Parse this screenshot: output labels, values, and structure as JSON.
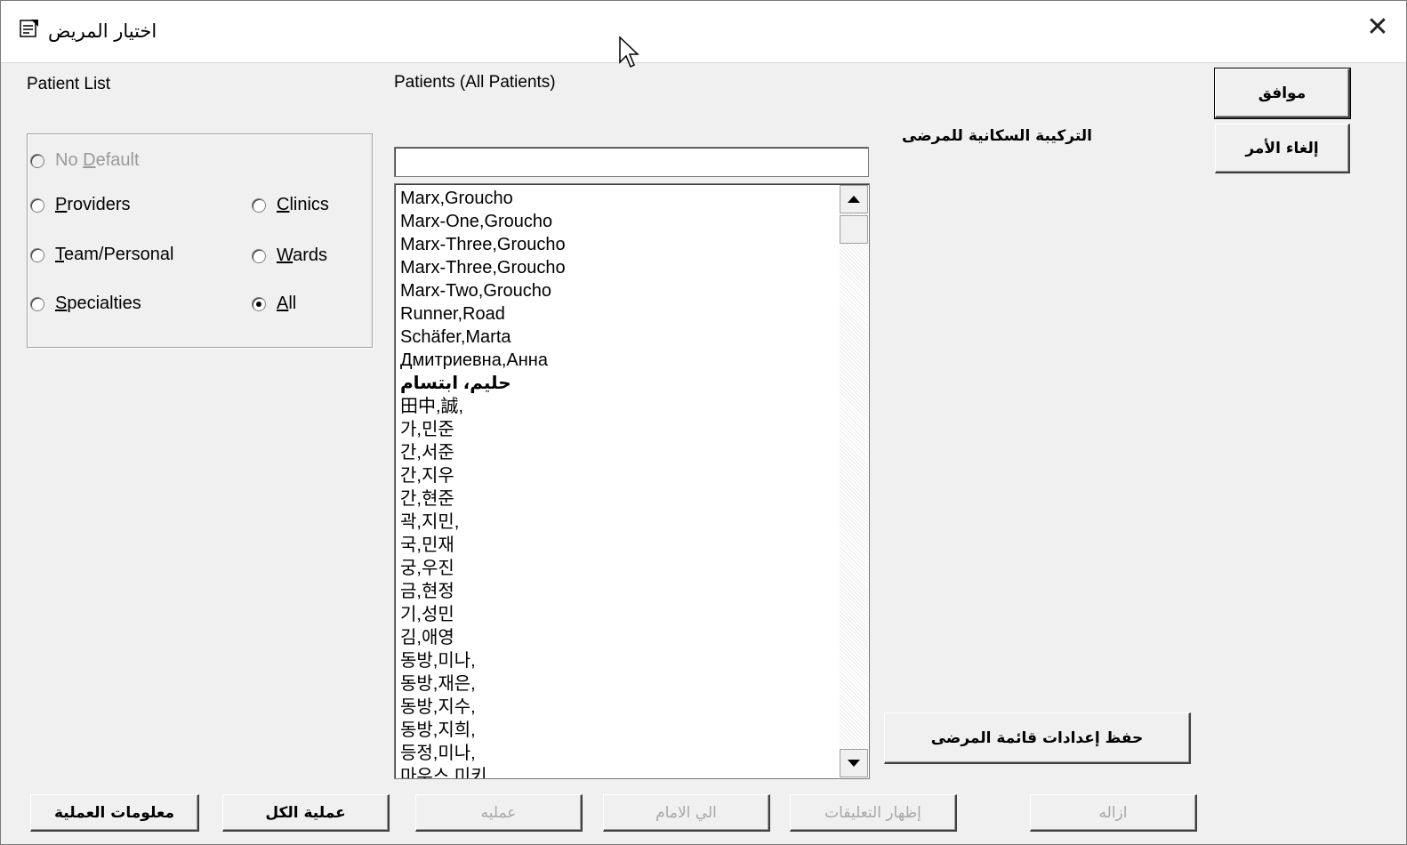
{
  "window": {
    "title": "اختيار المريض",
    "close_symbol": "✕"
  },
  "patient_list_panel": {
    "heading": "Patient List",
    "options": [
      {
        "key": "no_default",
        "label_prefix": "No ",
        "label_underlined": "D",
        "label_suffix": "efault",
        "checked": false,
        "disabled": true
      },
      {
        "key": "providers",
        "label_prefix": "",
        "label_underlined": "P",
        "label_suffix": "roviders",
        "checked": false,
        "disabled": false
      },
      {
        "key": "clinics",
        "label_prefix": "",
        "label_underlined": "C",
        "label_suffix": "linics",
        "checked": false,
        "disabled": false
      },
      {
        "key": "team_personal",
        "label_prefix": "",
        "label_underlined": "T",
        "label_suffix": "eam/Personal",
        "checked": false,
        "disabled": false
      },
      {
        "key": "wards",
        "label_prefix": "",
        "label_underlined": "W",
        "label_suffix": "ards",
        "checked": false,
        "disabled": false
      },
      {
        "key": "specialties",
        "label_prefix": "",
        "label_underlined": "S",
        "label_suffix": "pecialties",
        "checked": false,
        "disabled": false
      },
      {
        "key": "all",
        "label_prefix": "",
        "label_underlined": "A",
        "label_suffix": "ll",
        "checked": true,
        "disabled": false
      }
    ]
  },
  "patients_panel": {
    "heading": "Patients (All Patients)",
    "search_value": "",
    "items": [
      "Marx,Groucho",
      "Marx-One,Groucho",
      "Marx-Three,Groucho",
      "Marx-Three,Groucho",
      "Marx-Two,Groucho",
      "Runner,Road",
      "Schäfer,Marta",
      "Дмитриевна,Анна",
      "حليم، ابتسام",
      "田中,誠,",
      "가,민준",
      "간,서준",
      "간,지우",
      "간,현준",
      "곽,지민,",
      "국,민재",
      "궁,우진",
      "금,현정",
      "기,성민",
      "김,애영",
      "동방,미나,",
      "동방,재은,",
      "동방,지수,",
      "동방,지희,",
      "등정,미나,",
      "마우스,미키"
    ]
  },
  "demographics_label": "التركيبة السكانية للمرضى",
  "buttons": {
    "ok": "موافق",
    "cancel": "إلغاء الأمر",
    "save_settings": "حفظ إعدادات قائمة المرضى",
    "process_info": "معلومات العملية",
    "process_all": "عملية الكل",
    "process": "عمليه",
    "forward": "الي الامام",
    "show_notifications": "إظهار التعليقات",
    "remove": "ازاله"
  }
}
